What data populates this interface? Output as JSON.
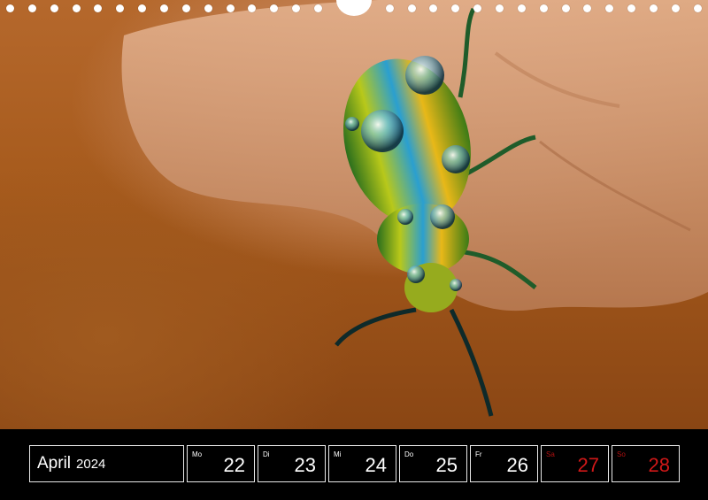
{
  "calendar": {
    "month": "April",
    "year": "2024",
    "days": [
      {
        "abbr": "Mo",
        "num": "22",
        "weekend": false
      },
      {
        "abbr": "Di",
        "num": "23",
        "weekend": false
      },
      {
        "abbr": "Mi",
        "num": "24",
        "weekend": false
      },
      {
        "abbr": "Do",
        "num": "25",
        "weekend": false
      },
      {
        "abbr": "Fr",
        "num": "26",
        "weekend": false
      },
      {
        "abbr": "Sa",
        "num": "27",
        "weekend": true
      },
      {
        "abbr": "So",
        "num": "28",
        "weekend": true
      }
    ]
  },
  "colors": {
    "strip": "#000000",
    "weekend": "#d01818",
    "text": "#ffffff"
  }
}
